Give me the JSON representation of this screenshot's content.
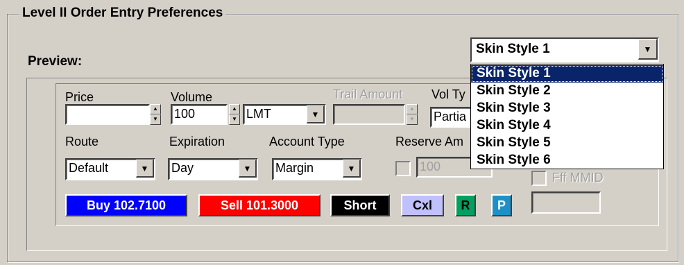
{
  "group": {
    "title": "Level II Order Entry Preferences"
  },
  "preview": {
    "label": "Preview:"
  },
  "skin": {
    "selected": "Skin Style 1",
    "options": [
      "Skin Style 1",
      "Skin Style 2",
      "Skin Style 3",
      "Skin Style 4",
      "Skin Style 5",
      "Skin Style 6"
    ]
  },
  "order": {
    "price_label": "Price",
    "price_value": "",
    "volume_label": "Volume",
    "volume_value": "100",
    "order_type_value": "LMT",
    "trail_label": "Trail Amount",
    "trail_value": "",
    "vol_type_label": "Vol Ty",
    "vol_type_value": "Partia",
    "route_label": "Route",
    "route_value": "Default",
    "expiration_label": "Expiration",
    "expiration_value": "Day",
    "account_type_label": "Account Type",
    "account_type_value": "Margin",
    "reserve_label": "Reserve Am",
    "reserve_value": "100",
    "hidden_label": "Fff MMID"
  },
  "buttons": {
    "buy": "Buy 102.7100",
    "sell": "Sell 101.3000",
    "short": "Short",
    "cxl": "Cxl",
    "r": "R",
    "p": "P"
  },
  "colors": {
    "buy": "#0000ff",
    "sell": "#ff0000",
    "short": "#000000",
    "cxl": "#c0c0ff",
    "r": "#00a060",
    "p": "#1e90c8",
    "highlight": "#0a246a"
  }
}
